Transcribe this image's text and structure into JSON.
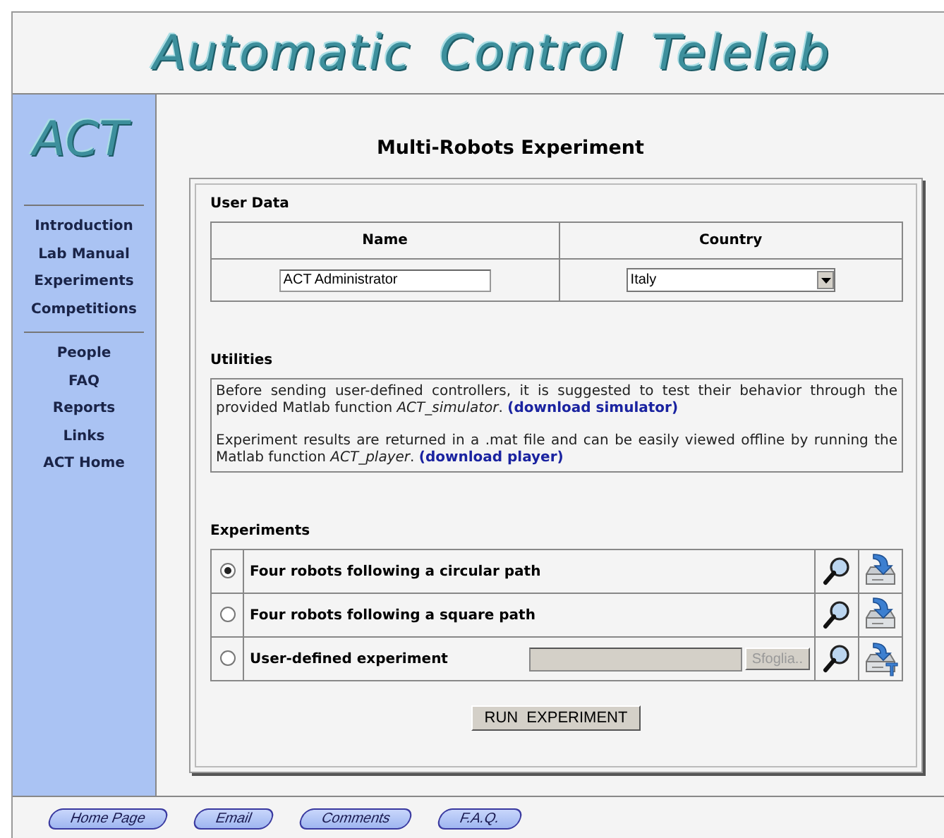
{
  "header": {
    "title": "Automatic Control Telelab"
  },
  "sidebar": {
    "logo": "ACT",
    "groups": [
      {
        "items": [
          "Introduction",
          "Lab Manual",
          "Experiments",
          "Competitions"
        ]
      },
      {
        "items": [
          "People",
          "FAQ",
          "Reports",
          "Links",
          "ACT Home"
        ]
      }
    ]
  },
  "page_title": "Multi-Robots Experiment",
  "user_data": {
    "heading": "User Data",
    "columns": [
      "Name",
      "Country"
    ],
    "name_value": "ACT Administrator",
    "country_value": "Italy"
  },
  "utilities": {
    "heading": "Utilities",
    "paragraphs": [
      {
        "text": "Before sending user-defined controllers, it is suggested to test their behavior through the provided Matlab function *ACT_simulator*.",
        "link": "(download simulator)"
      },
      {
        "text": "Experiment results are returned in a .mat file and can be easily viewed offline by running the Matlab function *ACT_player*.",
        "link": "(download player)"
      }
    ]
  },
  "experiments": {
    "heading": "Experiments",
    "rows": [
      {
        "kind": "preset",
        "label": "Four robots following a circular path",
        "selected": true
      },
      {
        "kind": "preset",
        "label": "Four robots following a square path",
        "selected": false
      },
      {
        "kind": "upload",
        "label": "User-defined experiment",
        "selected": false,
        "browse_button": "Sfoglia.."
      }
    ]
  },
  "run_button": "RUN EXPERIMENT",
  "footer": {
    "buttons": [
      "Home Page",
      "Email",
      "Comments",
      "F.A.Q."
    ]
  }
}
